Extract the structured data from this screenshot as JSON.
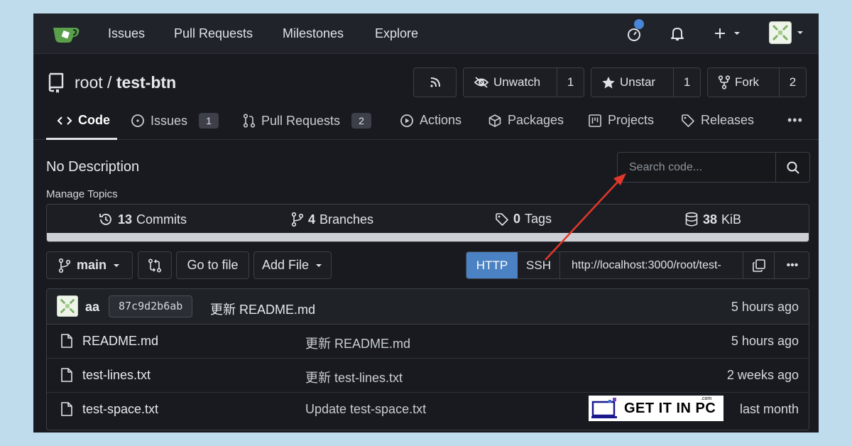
{
  "nav": {
    "links": [
      "Issues",
      "Pull Requests",
      "Milestones",
      "Explore"
    ],
    "icons": [
      "logo-icon",
      "activity-icon",
      "bell-icon",
      "plus-icon",
      "avatar"
    ]
  },
  "repo": {
    "owner": "root",
    "separator": "/",
    "name": "test-btn",
    "rss_icon": "rss-icon",
    "watch_label": "Unwatch",
    "watch_count": "1",
    "star_label": "Unstar",
    "star_count": "1",
    "fork_label": "Fork",
    "fork_count": "2"
  },
  "tabs": {
    "code": "Code",
    "issues": "Issues",
    "issues_count": "1",
    "pulls": "Pull Requests",
    "pulls_count": "2",
    "actions": "Actions",
    "packages": "Packages",
    "projects": "Projects",
    "releases": "Releases",
    "more": "•••"
  },
  "summary": {
    "description": "No Description",
    "manage_topics": "Manage Topics",
    "search_placeholder": "Search code..."
  },
  "stats": {
    "commits_num": "13",
    "commits_label": "Commits",
    "branches_num": "4",
    "branches_label": "Branches",
    "tags_num": "0",
    "tags_label": "Tags",
    "size_num": "38",
    "size_label": "KiB"
  },
  "toolbar": {
    "branch": "main",
    "go_to_file": "Go to file",
    "add_file": "Add File",
    "http": "HTTP",
    "ssh": "SSH",
    "clone_url": "http://localhost:3000/root/test-",
    "more": "•••"
  },
  "latest_commit": {
    "author": "aa",
    "sha": "87c9d2b6ab",
    "message": "更新 README.md",
    "time": "5 hours ago"
  },
  "files": [
    {
      "name": "README.md",
      "message": "更新 README.md",
      "time": "5 hours ago"
    },
    {
      "name": "test-lines.txt",
      "message": "更新 test-lines.txt",
      "time": "2 weeks ago"
    },
    {
      "name": "test-space.txt",
      "message": "Update test-space.txt",
      "time": "last month"
    }
  ],
  "watermark": {
    "text": "GET IT IN PC",
    "small": ".com"
  },
  "colors": {
    "accent": "#4b82c4",
    "arrow": "#e2372b",
    "background": "#bfdcec"
  }
}
